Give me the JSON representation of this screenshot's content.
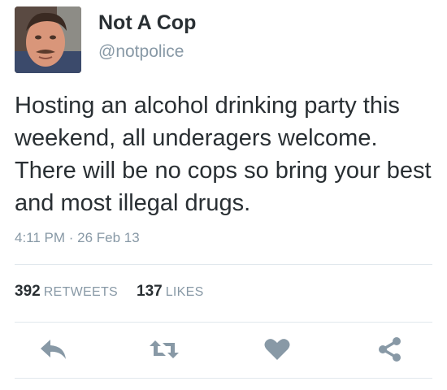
{
  "user": {
    "name": "Not A Cop",
    "handle": "@notpolice"
  },
  "tweet": {
    "text": "Hosting an alcohol drinking party this weekend, all underagers welcome. There will be no cops so bring your best and most illegal drugs.",
    "timestamp": "4:11 PM · 26 Feb 13"
  },
  "stats": {
    "retweets_count": "392",
    "retweets_label": "RETWEETS",
    "likes_count": "137",
    "likes_label": "LIKES"
  },
  "actions": [
    {
      "icon": "reply-icon"
    },
    {
      "icon": "retweet-icon"
    },
    {
      "icon": "heart-icon"
    },
    {
      "icon": "share-icon"
    }
  ],
  "colors": {
    "text": "#292f33",
    "muted": "#8899a6",
    "icon": "#8899a6",
    "divider": "#e1e8ed"
  }
}
